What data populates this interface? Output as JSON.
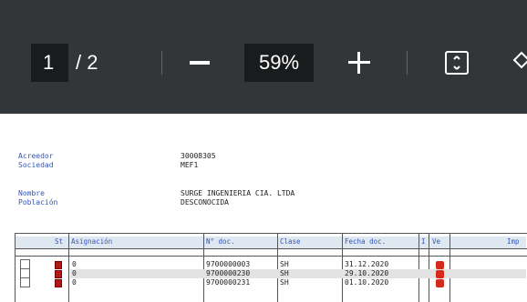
{
  "toolbar": {
    "current_page": "1",
    "page_separator_total": "/ 2",
    "zoom": "59%",
    "icons": [
      "zoom-out-icon",
      "zoom-in-icon",
      "fit-to-page-icon",
      "rotate-icon"
    ]
  },
  "vendor": {
    "acreedor_label": "Acreedor",
    "acreedor_value": "30008305",
    "sociedad_label": "Sociedad",
    "sociedad_value": "MEF1",
    "nombre_label": "Nombre",
    "nombre_value": "SURGE INGENIERIA CIA. LTDA",
    "poblacion_label": "Población",
    "poblacion_value": "DESCONOCIDA"
  },
  "table": {
    "headers": {
      "st": "St",
      "asignacion": "Asignación",
      "ndoc": "N° doc.",
      "clase": "Clase",
      "fecha": "Fecha doc.",
      "i": "I",
      "ve": "Ve",
      "imp": "Imp"
    },
    "rows": [
      {
        "asignacion": "0",
        "ndoc": "9700000003",
        "clase": "SH",
        "fecha": "31.12.2020"
      },
      {
        "asignacion": "0",
        "ndoc": "9700000230",
        "clase": "SH",
        "fecha": "29.10.2020"
      },
      {
        "asignacion": "0",
        "ndoc": "9700000231",
        "clase": "SH",
        "fecha": "01.10.2020"
      }
    ]
  }
}
